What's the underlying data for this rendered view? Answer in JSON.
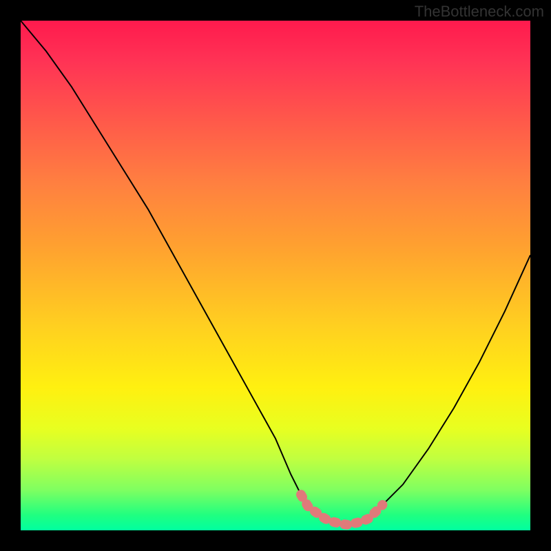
{
  "watermark": "TheBottleneck.com",
  "chart_data": {
    "type": "line",
    "title": "",
    "xlabel": "",
    "ylabel": "",
    "xlim": [
      0,
      100
    ],
    "ylim": [
      0,
      100
    ],
    "series": [
      {
        "name": "bottleneck-curve",
        "x": [
          0,
          5,
          10,
          15,
          20,
          25,
          30,
          35,
          40,
          45,
          50,
          53,
          56,
          60,
          64,
          68,
          70,
          75,
          80,
          85,
          90,
          95,
          100
        ],
        "y": [
          100,
          94,
          87,
          79,
          71,
          63,
          54,
          45,
          36,
          27,
          18,
          11,
          5,
          2,
          1,
          2,
          4,
          9,
          16,
          24,
          33,
          43,
          54
        ]
      }
    ],
    "highlight_band": {
      "name": "optimal-range",
      "x_start": 55,
      "x_end": 71,
      "color": "#e07a7a"
    },
    "gradient_stops": [
      {
        "pos": 0.0,
        "color": "#ff1a4d"
      },
      {
        "pos": 0.2,
        "color": "#ff5a4a"
      },
      {
        "pos": 0.44,
        "color": "#ffa030"
      },
      {
        "pos": 0.72,
        "color": "#fff010"
      },
      {
        "pos": 0.92,
        "color": "#80ff60"
      },
      {
        "pos": 1.0,
        "color": "#00ffa0"
      }
    ]
  }
}
